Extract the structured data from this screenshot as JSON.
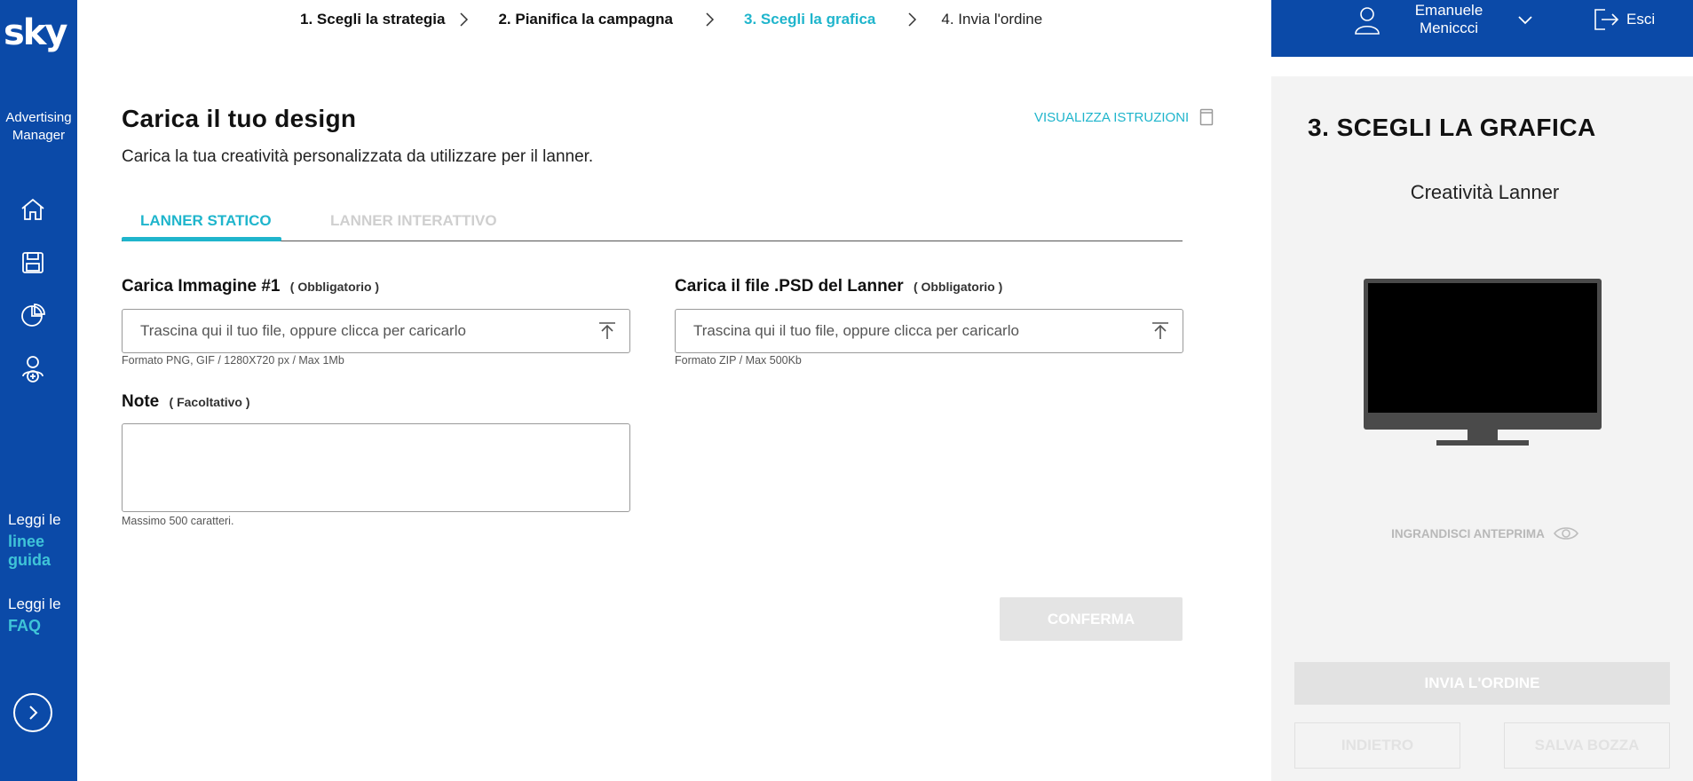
{
  "sidebar": {
    "logo": "sky",
    "product_line1": "Advertising",
    "product_line2": "Manager",
    "nav": [
      "home-icon",
      "save-icon",
      "pie-chart-icon",
      "user-add-icon"
    ],
    "guide_prefix": "Leggi le",
    "guide_link_1": "linee",
    "guide_link_2": "guida",
    "faq_prefix": "Leggi le",
    "faq_link": "FAQ",
    "expand_icon": "chevron-right-icon"
  },
  "stepper": {
    "steps": [
      "1. Scegli la strategia",
      "2. Pianifica la campagna",
      "3. Scegli la grafica",
      "4. Invia l'ordine"
    ],
    "active_index": 2
  },
  "main": {
    "title": "Carica il tuo design",
    "subtitle": "Carica la tua creatività personalizzata da utilizzare per il lanner.",
    "instructions_link": "VISUALIZZA ISTRUZIONI",
    "tabs": [
      "LANNER STATICO",
      "LANNER INTERATTIVO"
    ],
    "upload_image": {
      "label": "Carica Immagine #1",
      "requirement": "( Obbligatorio )",
      "placeholder": "Trascina qui il tuo file, oppure clicca per caricarlo",
      "hint": "Formato PNG, GIF / 1280X720 px / Max 1Mb"
    },
    "upload_psd": {
      "label": "Carica il file .PSD del Lanner",
      "requirement": "( Obbligatorio )",
      "placeholder": "Trascina qui il tuo file, oppure clicca per caricarlo",
      "hint": "Formato ZIP / Max 500Kb"
    },
    "notes": {
      "label": "Note",
      "requirement": "( Facoltativo )",
      "value": "",
      "hint": "Massimo 500 caratteri."
    },
    "confirm_label": "CONFERMA"
  },
  "user": {
    "first_name": "Emanuele",
    "last_name": "Meniccci",
    "logout_label": "Esci"
  },
  "panel": {
    "title": "3. SCEGLI LA GRAFICA",
    "subtitle": "Creatività Lanner",
    "enlarge_label": "INGRANDISCI ANTEPRIMA",
    "send_label": "INVIA L'ORDINE",
    "back_label": "INDIETRO",
    "draft_label": "SALVA BOZZA"
  },
  "colors": {
    "brand_blue": "#0b4aa8",
    "accent_teal": "#1fb5cc"
  }
}
